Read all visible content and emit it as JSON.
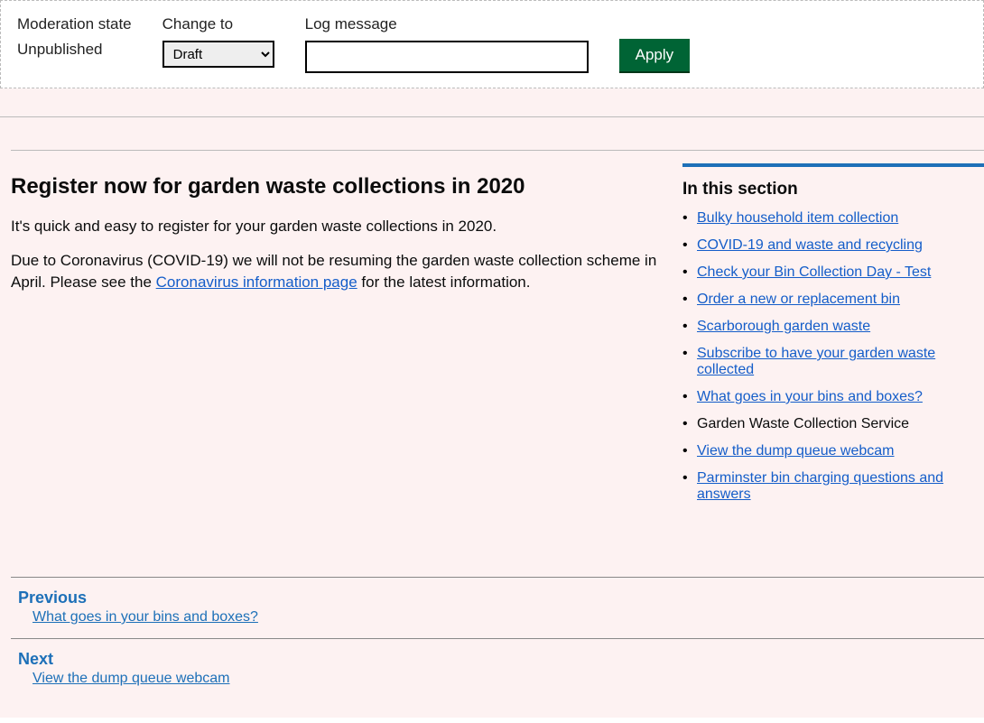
{
  "moderation": {
    "state_label": "Moderation state",
    "state_value": "Unpublished",
    "change_label": "Change to",
    "change_value": "Draft",
    "log_label": "Log message",
    "log_value": "",
    "apply_label": "Apply"
  },
  "main": {
    "heading": "Register now for garden waste collections in 2020",
    "para1": "It's quick and easy to register for your garden waste collections in 2020.",
    "para2_a": "Due to Coronavirus (COVID-19) we will not be resuming the garden waste collection scheme in April. Please see the ",
    "para2_link": "Coronavirus information page",
    "para2_b": " for the latest information."
  },
  "sidebar": {
    "heading": "In this section",
    "items": [
      {
        "label": "Bulky household item collection",
        "current": false
      },
      {
        "label": "COVID-19 and waste and recycling",
        "current": false
      },
      {
        "label": "Check your Bin Collection Day - Test",
        "current": false
      },
      {
        "label": "Order a new or replacement bin",
        "current": false
      },
      {
        "label": "Scarborough garden waste",
        "current": false
      },
      {
        "label": "Subscribe to have your garden waste collected",
        "current": false
      },
      {
        "label": "What goes in your bins and boxes?",
        "current": false
      },
      {
        "label": "Garden Waste Collection Service",
        "current": true
      },
      {
        "label": "View the dump queue webcam",
        "current": false
      },
      {
        "label": "Parminster bin charging questions and answers",
        "current": false
      }
    ]
  },
  "pager": {
    "prev_label": "Previous",
    "prev_link": "What goes in your bins and boxes?",
    "next_label": "Next",
    "next_link": "View the dump queue webcam"
  }
}
